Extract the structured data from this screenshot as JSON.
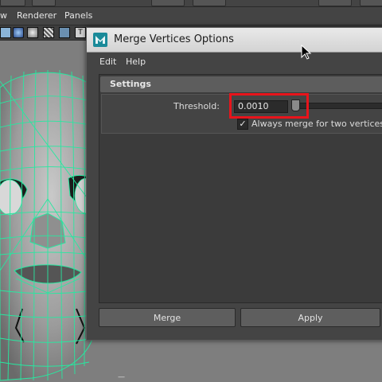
{
  "maya": {
    "menubar": {
      "items": [
        "w",
        "Renderer",
        "Panels"
      ]
    }
  },
  "dialog": {
    "title": "Merge Vertices Options",
    "icon": "maya-app-icon",
    "menu": [
      "Edit",
      "Help"
    ],
    "settings": {
      "header": "Settings",
      "threshold_label": "Threshold:",
      "threshold_value": "0.0010",
      "always_merge_label": "Always merge for two vertices",
      "always_merge_checked": true
    },
    "buttons": {
      "merge": "Merge",
      "apply": "Apply"
    }
  },
  "colors": {
    "highlight": "#e8141b",
    "wireframe": "#27e8a0",
    "panel": "#444444"
  }
}
